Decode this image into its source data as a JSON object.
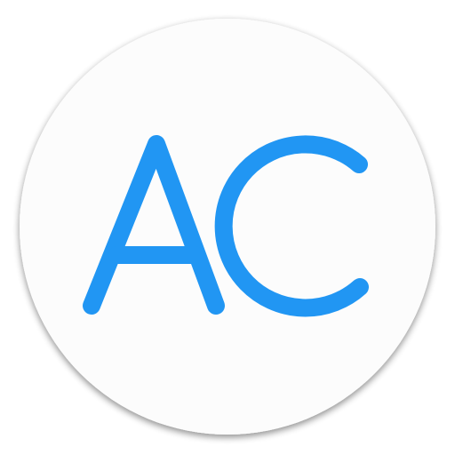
{
  "app_icon": {
    "monogram": "AC",
    "icon_name": "ac-app-icon",
    "colors": {
      "letter": "#2196F3",
      "disc": "#FCFCFC",
      "shadow": "#BDBDBD",
      "background": "#FFFFFF"
    }
  }
}
